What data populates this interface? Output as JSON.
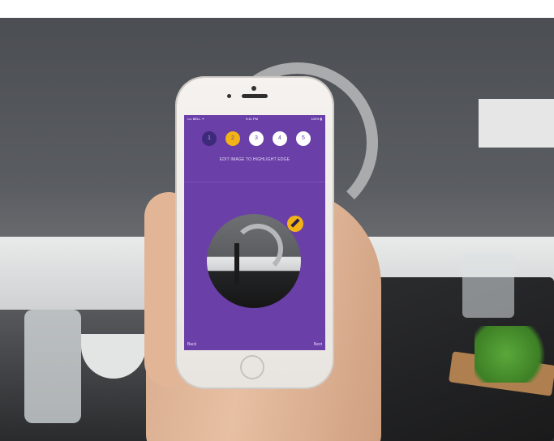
{
  "status_bar": {
    "carrier": "•••• BELL ᯤ",
    "time": "9:41 PM",
    "battery": "100% ▮"
  },
  "steps": [
    {
      "label": "1",
      "state": "done"
    },
    {
      "label": "2",
      "state": "active"
    },
    {
      "label": "3",
      "state": "pending"
    },
    {
      "label": "4",
      "state": "pending"
    },
    {
      "label": "5",
      "state": "pending"
    }
  ],
  "instruction": "EDIT IMAGE TO HIGHLIGHT EDGE",
  "nav": {
    "back_label": "Back",
    "next_label": "Next"
  },
  "icons": {
    "edit": "pencil-icon"
  },
  "colors": {
    "screen_bg": "#6a3fa8",
    "accent": "#f2b316",
    "step_done": "#3d2a7a"
  }
}
